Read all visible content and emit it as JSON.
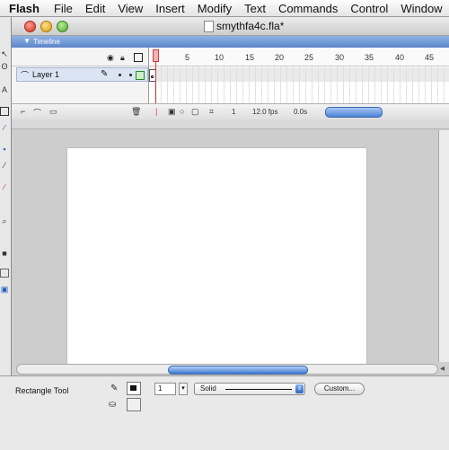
{
  "menu": {
    "items": [
      "Flash",
      "File",
      "Edit",
      "View",
      "Insert",
      "Modify",
      "Text",
      "Commands",
      "Control",
      "Window"
    ]
  },
  "window": {
    "title": "smythfa4c.fla*"
  },
  "timeline": {
    "header": "Timeline",
    "layer_name": "Layer 1",
    "frame_numbers": [
      "5",
      "10",
      "15",
      "20",
      "25",
      "30",
      "35",
      "40",
      "45"
    ],
    "status": {
      "frame": "1",
      "fps": "12.0 fps",
      "time": "0.0s"
    }
  },
  "properties": {
    "tool_name": "Rectangle Tool",
    "stroke_height": "1",
    "stroke_style": "Solid",
    "custom_button": "Custom..."
  },
  "colors": {
    "timeline_header": "#5d86c9",
    "playhead": "#d63a3a",
    "scroll_thumb": "#3f79d2",
    "stage": "#ffffff",
    "workspace": "#cdcdcd"
  }
}
